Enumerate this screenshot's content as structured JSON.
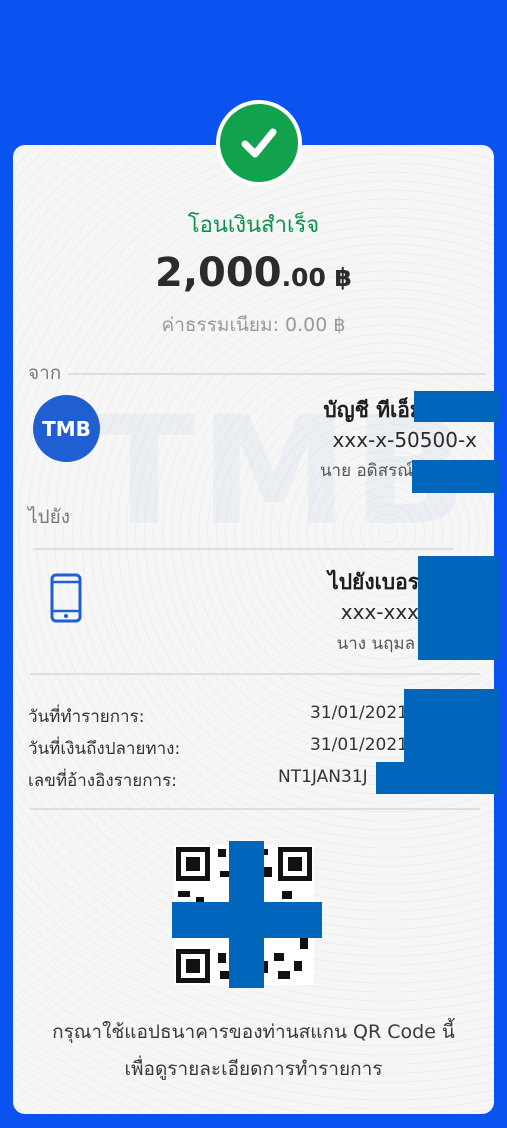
{
  "status": {
    "title": "โอนเงินสำเร็จ"
  },
  "amount": {
    "main": "2,000",
    "decimal": ".00 ฿"
  },
  "fee": "ค่าธรรมเนียม: 0.00 ฿",
  "from": {
    "section_label": "จาก",
    "bank_logo_text": "TMB",
    "account_title": "บัญชี ทีเอ็มบี",
    "account_number": "xxx-x-50500-x",
    "account_name": "นาย อดิสรณ์"
  },
  "to": {
    "section_label": "ไปยัง",
    "account_title": "ไปยังเบอร",
    "account_number": "xxx-xxx",
    "account_name": "นาง นฤมล"
  },
  "details": [
    {
      "label": "วันที่ทำรายการ:",
      "value": "31/01/2021"
    },
    {
      "label": "วันที่เงินถึงปลายทาง:",
      "value": "31/01/2021"
    },
    {
      "label": "เลขที่อ้างอิงรายการ:",
      "value": "NT1JAN31J"
    }
  ],
  "footer": {
    "line1": "กรุณาใช้แอปธนาคารของท่านสแกน QR Code นี้",
    "line2": "เพื่อดูรายละเอียดการทำรายการ"
  },
  "colors": {
    "background": "#0a53f0",
    "success": "#12a14d",
    "tmb_blue": "#1f5fd1",
    "redaction": "#0066bb"
  },
  "icons": [
    "check-icon",
    "phone-icon",
    "qr-code"
  ]
}
